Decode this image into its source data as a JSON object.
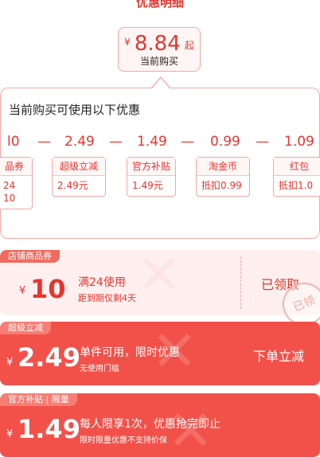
{
  "title": "优惠明细",
  "current_price": {
    "currency": "¥",
    "amount": "8.84",
    "suffix": "起",
    "label": "当前购买"
  },
  "panel": {
    "heading": "当前购买可使用以下优惠",
    "calc": [
      "l0",
      "—",
      "2.49",
      "—",
      "1.49",
      "—",
      "0.99",
      "—",
      "1.09"
    ],
    "tags": [
      {
        "title": "品券",
        "lines": [
          "24",
          "10"
        ]
      },
      {
        "title": "超级立减",
        "lines": [
          "2.49元"
        ]
      },
      {
        "title": "官方补贴",
        "lines": [
          "1.49元"
        ]
      },
      {
        "title": "淘金币",
        "lines": [
          "抵扣0.99"
        ]
      },
      {
        "title": "红包",
        "lines": [
          "抵扣1.0"
        ]
      }
    ]
  },
  "coupons": [
    {
      "corner": "店铺商品券",
      "currency": "¥",
      "value": "10",
      "line1": "满24使用",
      "line2": "距到期仅剩4天",
      "action": "已领取",
      "stamp": "已领"
    },
    {
      "corner": "超级立减",
      "currency": "¥",
      "value": "2.49",
      "line1": "单件可用，限时优惠",
      "line2": "无使用门槛",
      "action": "下单立减"
    },
    {
      "corner": "官方补贴 | 限量",
      "currency": "¥",
      "value": "1.49",
      "line1": "每人限享1次，优惠抢完即止",
      "line2": "限时限量优惠不支持价保",
      "action": ""
    }
  ],
  "colors": {
    "accent": "#e8342e",
    "card_red": "#f2514a",
    "card_light": "#fff0ef"
  }
}
